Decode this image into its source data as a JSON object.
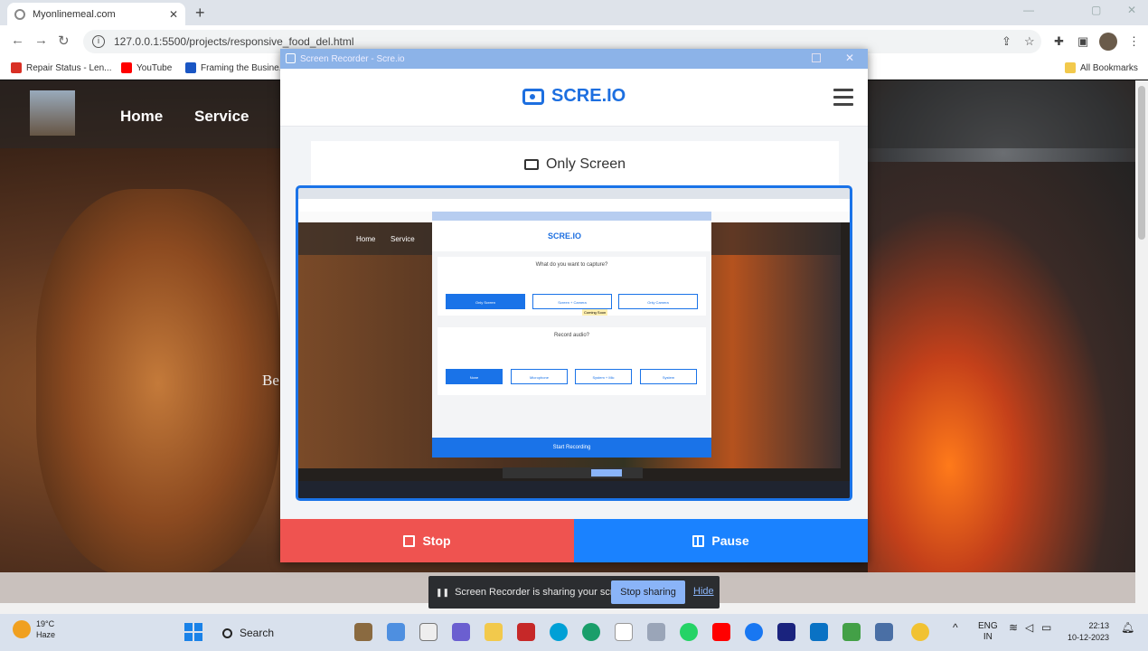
{
  "browser": {
    "tab_title": "Myonlinemeal.com",
    "tab_close": "✕",
    "new_tab": "+",
    "url": "127.0.0.1:5500/projects/responsive_food_del.html",
    "bookmarks": [
      {
        "label": "Repair Status - Len...",
        "color": "#d93025"
      },
      {
        "label": "YouTube",
        "color": "#ff0000"
      },
      {
        "label": "Framing the Busine...",
        "color": "#1a56c4"
      }
    ],
    "all_bookmarks": "All Bookmarks"
  },
  "site": {
    "nav": [
      "Home",
      "Service"
    ],
    "side_text": "Be"
  },
  "recorder": {
    "window_title": "Screen Recorder - Scre.io",
    "brand": "SCRE.IO",
    "mode_label": "Only Screen",
    "stop_label": "Stop",
    "pause_label": "Pause",
    "accent": "#1a73e8",
    "stop_color": "#ef5350"
  },
  "preview": {
    "brand": "SCRE.IO",
    "nav": [
      "Home",
      "Service"
    ],
    "capture_question": "What do you want to capture?",
    "capture_options": [
      "Only Screen",
      "Screen + Camera",
      "Only Camera"
    ],
    "tooltip": "Coming Soon",
    "audio_question": "Record audio?",
    "audio_options": [
      "None",
      "Microphone",
      "System + Mic",
      "System"
    ],
    "start_label": "Start Recording"
  },
  "sharebar": {
    "message": "Screen Recorder is sharing your screen.",
    "stop_label": "Stop sharing",
    "hide_label": "Hide"
  },
  "taskbar": {
    "temp": "19°C",
    "condition": "Haze",
    "search": "Search",
    "lang": "ENG",
    "lang_sub": "IN",
    "time": "22:13",
    "date": "10-12-2023"
  }
}
